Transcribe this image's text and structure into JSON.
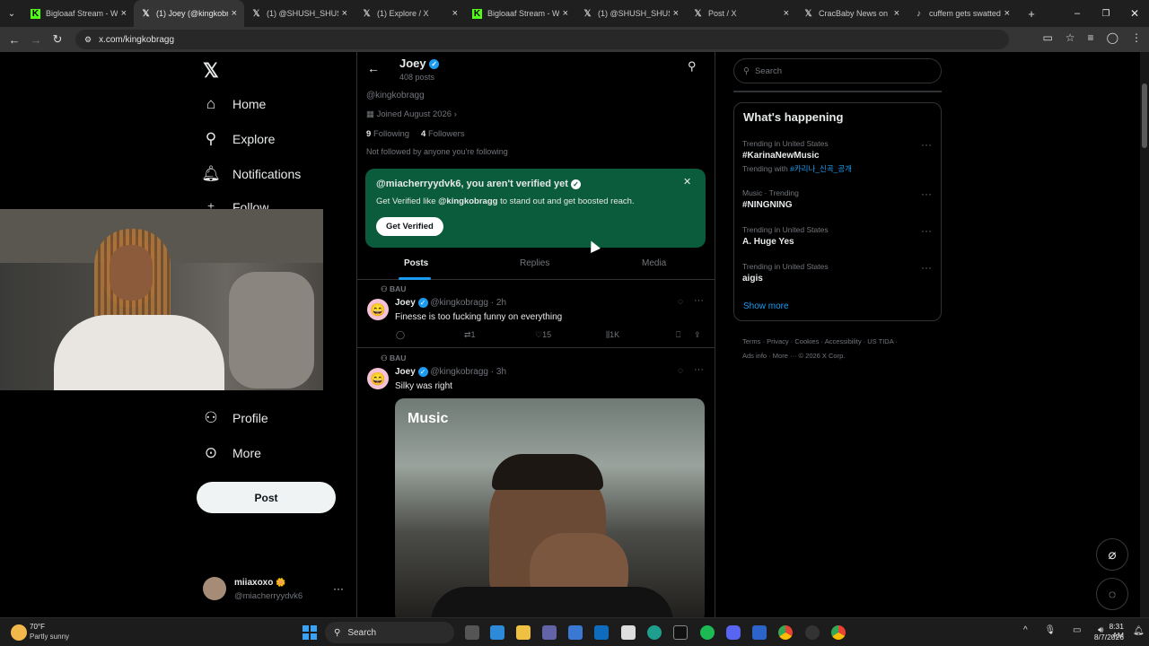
{
  "browser": {
    "tabs": [
      {
        "title": "Bigloaaf Stream - Wa",
        "icon": "kick-icon",
        "active": false
      },
      {
        "title": "(1) Joey (@kingkobra",
        "icon": "x-icon",
        "active": true
      },
      {
        "title": "(1) @SHUSH_SHUSH",
        "icon": "x-icon",
        "active": false
      },
      {
        "title": "(1) Explore / X",
        "icon": "x-icon",
        "active": false
      },
      {
        "title": "Bigloaaf Stream - Wa",
        "icon": "kick-icon",
        "active": false
      },
      {
        "title": "(1) @SHUSH_SHUSH",
        "icon": "x-icon",
        "active": false
      },
      {
        "title": "Post / X",
        "icon": "x-icon",
        "active": false
      },
      {
        "title": "CracBaby News on X",
        "icon": "x-icon",
        "active": false
      },
      {
        "title": "cuffem gets swatted",
        "icon": "tiktok-icon",
        "active": false
      }
    ],
    "url": "x.com/kingkobragg"
  },
  "sidebar": {
    "items": [
      {
        "label": "Home",
        "icon": "home-icon"
      },
      {
        "label": "Explore",
        "icon": "search-icon"
      },
      {
        "label": "Notifications",
        "icon": "bell-icon"
      },
      {
        "label": "Follow",
        "icon": "add-person-icon"
      },
      {
        "label": "Profile",
        "icon": "person-icon"
      },
      {
        "label": "More",
        "icon": "more-circle-icon"
      }
    ],
    "post_label": "Post",
    "account": {
      "name": "miiaxoxo",
      "handle": "@miacherryydvk6",
      "badge": "🌼"
    }
  },
  "profile": {
    "name": "Joey",
    "posts_count": "408 posts",
    "handle": "@kingkobragg",
    "joined": "Joined August 2026",
    "following_count": "9",
    "following_label": "Following",
    "followers_count": "4",
    "followers_label": "Followers",
    "not_followed": "Not followed by anyone you're following"
  },
  "verify_card": {
    "title": "@miacherryydvk6, you aren't verified yet",
    "body_prefix": "Get Verified like ",
    "body_handle": "@kingkobragg",
    "body_suffix": " to stand out and get boosted reach.",
    "button": "Get Verified",
    "bg_color": "#0a5c3c"
  },
  "tabs": [
    "Posts",
    "Replies",
    "Media"
  ],
  "posts": [
    {
      "community": "BAU",
      "name": "Joey",
      "handle": "@kingkobragg",
      "time": "· 2h",
      "text": "Finesse is too fucking funny on everything",
      "retweets": "1",
      "likes": "15",
      "views": "1K"
    },
    {
      "community": "BAU",
      "name": "Joey",
      "handle": "@kingkobragg",
      "time": "· 3h",
      "text": "Silky was right",
      "media_label": "Music"
    }
  ],
  "right": {
    "search_placeholder": "Search",
    "happening_title": "What's happening",
    "trends": [
      {
        "meta": "Trending in United States",
        "name": "#KarinaNewMusic",
        "extra_prefix": "Trending with ",
        "extra_tag": "#카리나_신곡_공개"
      },
      {
        "meta": "Music · Trending",
        "name": "#NINGNING"
      },
      {
        "meta": "Trending in United States",
        "name": "A. Huge Yes"
      },
      {
        "meta": "Trending in United States",
        "name": "aigis"
      }
    ],
    "show_more": "Show more",
    "footer": [
      "Terms",
      "Privacy",
      "Cookies",
      "Accessibility",
      "US TIDA",
      "Ads info",
      "More ···",
      "© 2026 X Corp."
    ]
  },
  "taskbar": {
    "weather_temp": "70°F",
    "weather_desc": "Partly sunny",
    "search_label": "Search",
    "time": "8:31 AM",
    "date": "8/7/2026"
  }
}
